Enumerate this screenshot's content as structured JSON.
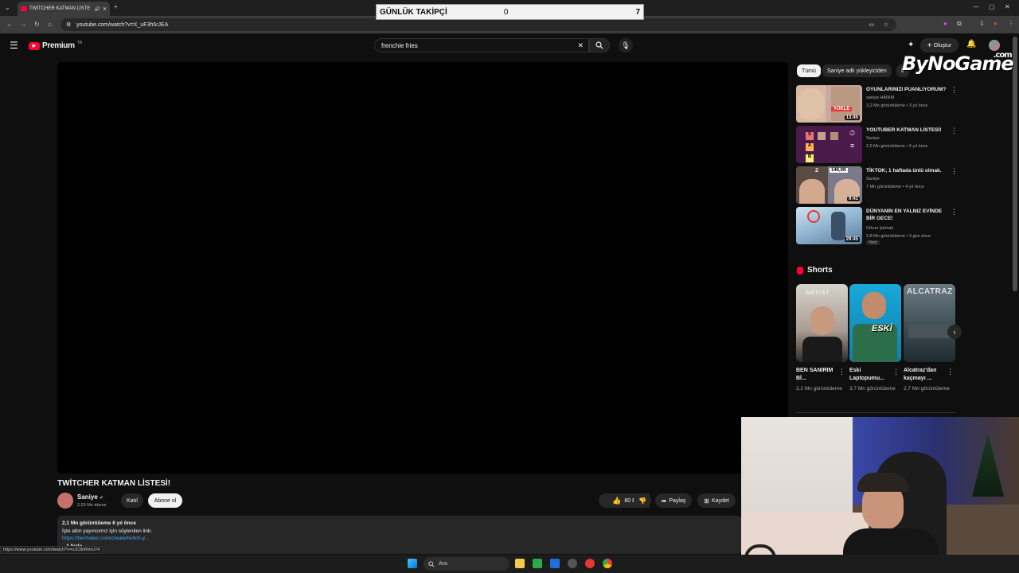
{
  "browser": {
    "tab_title": "TWİTCHER KATMAN LİSTE",
    "url": "youtube.com/watch?v=X_uF3h5rJEA",
    "status_url": "https://www.youtube.com/watch?v=nJC8nfhmU74"
  },
  "counter": {
    "label": "GÜNLÜK TAKİPÇİ",
    "value1": "0",
    "value2": "7"
  },
  "header": {
    "logo_text": "Premium",
    "logo_badge": "TR",
    "search_value": "frenchie fries",
    "create_label": "Oluştur"
  },
  "video": {
    "title": "TWİTCHER KATMAN LİSTESİ!",
    "channel": "Saniye",
    "subscribers": "2,03 Mn abone",
    "join_label": "Katıl",
    "subscribe_label": "Abone ol",
    "likes": "80 B",
    "share_label": "Paylaş",
    "save_label": "Kaydet",
    "desc_stats": "2,1 Mn görüntüleme  6 yıl önce",
    "desc_line": "İşte altın yayıncımız için söylenilen link:",
    "desc_link": "https://tiermaker.com/create/twitch-y...",
    "desc_more": "...1 fazla"
  },
  "chips": [
    "Tümü",
    "Saniye adlı yükleyiciden",
    "İl"
  ],
  "watermark": {
    "text": "ByNoGame",
    "suffix": ".com"
  },
  "recommendations": [
    {
      "title": "OYUNLARINIZI PUANLIYORUM?",
      "channel": "saniye HANIM",
      "meta": "3,2 Mn görüntüleme • 3 yıl önce",
      "duration": "13:45",
      "thumb_text": "YÜKLE"
    },
    {
      "title": "YOUTUBER KATMAN LİSTESİ!",
      "channel": "Saniye",
      "meta": "2,5 Mn görüntüleme • 6 yıl önce",
      "duration": "",
      "tiers": [
        "S",
        "A",
        "B"
      ]
    },
    {
      "title": "TİKTOK; 1 haftada ünlü olmak.",
      "channel": "Saniye",
      "meta": "7 Mn görüntüleme • 4 yıl önce",
      "duration": "9:41",
      "thumb_left": "2",
      "thumb_right": "146,0K"
    },
    {
      "title": "DÜNYANIN EN YALNIZ EVİNDE BİR GECE!",
      "channel": "Orkun Işıtmak",
      "meta": "2,8 Mn görüntüleme • 3 gün önce",
      "duration": "29:45",
      "badge": "Yeni"
    }
  ],
  "shorts": {
    "heading": "Shorts",
    "items": [
      {
        "title": "BEN SANIRIM Bİ...",
        "views": "2,2 Mn görüntüleme",
        "thumb_text": "ARTIST"
      },
      {
        "title": "Eski Laptopumu...",
        "views": "3,7 Mn görüntüleme",
        "thumb_text": "ESKİ"
      },
      {
        "title": "Alcatraz'dan kaçmayı ...",
        "views": "2,7 Mn görüntüleme",
        "thumb_text": "ALCATRAZ"
      }
    ]
  },
  "taskbar": {
    "search_label": "Ara"
  },
  "colors": {
    "accent": "#ff0033",
    "link": "#3ea6ff",
    "background": "#0f0f0f"
  }
}
